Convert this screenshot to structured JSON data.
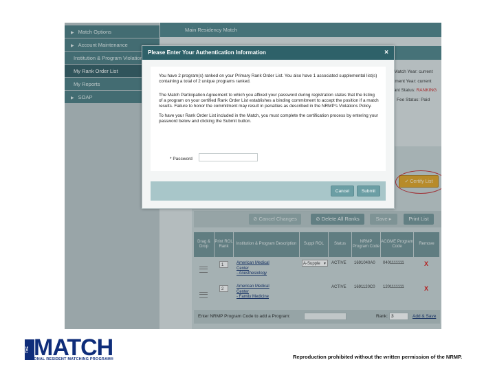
{
  "sidebar": {
    "items": [
      {
        "label": "Match Options",
        "arrow": "▶"
      },
      {
        "label": "Account Maintenance",
        "arrow": "▶"
      },
      {
        "label": "Institution & Program Violations",
        "arrow": ""
      },
      {
        "label": "My Rank Order List",
        "arrow": ""
      },
      {
        "label": "My Reports",
        "arrow": ""
      },
      {
        "label": "SOAP",
        "arrow": "▶"
      }
    ]
  },
  "header": {
    "title": "Main Residency Match"
  },
  "status": {
    "match_year_label": "Match Year:",
    "match_year_value": "current",
    "appointment_year_label": "ntment Year:",
    "appointment_year_value": "current",
    "applicant_status_label": "icant Status:",
    "applicant_status_value": "RANKING",
    "fee_status_label": "Fee Status:",
    "fee_status_value": "Paid"
  },
  "actions": {
    "certify_label": "Certify List",
    "cancel_changes_label": "Cancel Changes",
    "delete_all_label": "Delete All Ranks",
    "save_label": "Save",
    "print_label": "Print List"
  },
  "table": {
    "headers": [
      "Drag & Drop",
      "Print ROL Rank",
      "Institution & Program Description",
      "Suppl ROL",
      "Status",
      "NRMP Program Code",
      "ACGME Program Code",
      "Remove"
    ],
    "rows": [
      {
        "rank": "1",
        "inst1": "American Medical",
        "inst2": "Center",
        "inst3": "- Anesthesiology",
        "suppl": "A-Supple",
        "status": "ACTIVE",
        "nrmp": "1691040A0",
        "acgme": "0401111111",
        "remove": "X"
      },
      {
        "rank": "2",
        "inst1": "American Medical",
        "inst2": "Center",
        "inst3": "- Family Medicine",
        "suppl": "",
        "status": "ACTIVE",
        "nrmp": "1691120C0",
        "acgme": "1201111111",
        "remove": "X"
      }
    ]
  },
  "add_program": {
    "label": "Enter NRMP Program Code to add a Program:",
    "rank_label": "Rank:",
    "rank_value": "3",
    "add_save_label": "Add & Save"
  },
  "modal": {
    "title": "Please Enter Your Authentication Information",
    "close": "×",
    "para1": "You have 2 program(s) ranked on your Primary Rank Order List. You also have 1 associated supplemental list(s) containing a total of 2 unique programs ranked.",
    "para2": "The Match Participation Agreement to which you affixed your password during registration states that the listing of a program on your certified Rank Order List establishes a binding commitment to accept the position if a match results. Failure to honor the commitment may result in penalties as described in the NRMP's Violations Policy.",
    "para3": "To have your Rank Order List included in the Match, you must complete the certification process by entering your password below and clicking the Submit button.",
    "password_label": "* Password",
    "password_value": "",
    "cancel_label": "Cancel",
    "submit_label": "Submit"
  },
  "branding": {
    "logo_the": "THE",
    "logo_main": "MATCH",
    "logo_sub": "NATIONAL RESIDENT MATCHING PROGRAM®",
    "footer_note": "Reproduction prohibited without the written permission of the NRMP."
  },
  "colors": {
    "brand_dark": "#2e6169",
    "highlight_orange": "#e0a21f",
    "danger_red": "#cc1a1a",
    "logo_blue": "#0f2d7a"
  }
}
